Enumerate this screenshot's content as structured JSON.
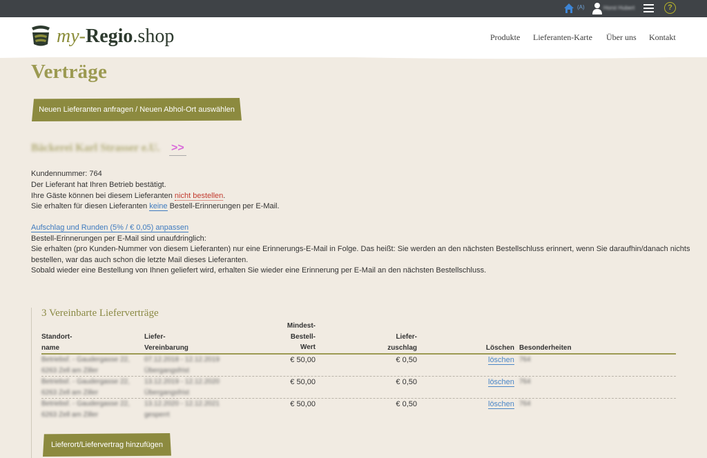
{
  "topbar": {
    "home_icon": "home-icon",
    "level": "(A)",
    "user_icon": "user-icon",
    "user_name": "Horst Hubert",
    "menu_icon": "hamburger-menu-icon",
    "help_label": "?"
  },
  "header": {
    "logo_my": "my-",
    "logo_regio": "Regio",
    "logo_shop": ".shop",
    "nav": [
      "Produkte",
      "Lieferanten-Karte",
      "Über uns",
      "Kontakt"
    ]
  },
  "page": {
    "title": "Verträge",
    "new_supplier_button": "Neuen Lieferanten anfragen / Neuen Abhol-Ort auswählen"
  },
  "supplier": {
    "name": "Bäckerei Karl Strasser e.U.",
    "link": ">>",
    "customer_number": "Kundennummer: 764",
    "confirmed": "Der Lieferant hat Ihren Betrieb bestätigt.",
    "guests_prefix": "Ihre Gäste können bei diesem Lieferanten ",
    "guests_link": "nicht bestellen",
    "guests_suffix": ".",
    "reminders_prefix": "Sie erhalten für diesen Lieferanten ",
    "reminders_link": "keine",
    "reminders_suffix": " Bestell-Erinnerungen per E-Mail.",
    "surcharge_link": "Aufschlag und Runden (5% / € 0,05) anpassen",
    "info": [
      "Bestell-Erinnerungen per E-Mail sind unaufdringlich:",
      "Sie erhalten (pro Kunden-Nummer von diesem Lieferanten) nur eine Erinnerungs-E-Mail in Folge. Das heißt: Sie werden an den nächsten Bestellschluss erinnert, wenn Sie daraufhin/danach nichts",
      "bestellen, war das auch schon die letzte Mail dieses Lieferanten.",
      "Sobald wieder eine Bestellung von Ihnen geliefert wird, erhalten Sie wieder eine Erinnerung per E-Mail an den nächsten Bestellschluss."
    ]
  },
  "contracts": {
    "title": "3 Vereinbarte Lieferverträge",
    "headers": {
      "location": [
        "Standort-",
        "name"
      ],
      "agreement": [
        "Liefer-",
        "Vereinbarung"
      ],
      "min_value": [
        "Mindest-",
        "Bestell-",
        "Wert"
      ],
      "surcharge": [
        "Liefer-",
        "zuschlag"
      ],
      "delete": "Löschen",
      "special": "Besonderheiten"
    },
    "rows": [
      {
        "location": [
          "Betriebsf. - Gaudergasse 22,",
          "6263 Zell am Ziller"
        ],
        "agreement": [
          "07.12.2018 - 12.12.2019",
          "Übergangsfrist"
        ],
        "min_value": "€ 50,00",
        "surcharge": "€ 0,50",
        "delete": "löschen",
        "special": "764"
      },
      {
        "location": [
          "Betriebsf. - Gaudergasse 22,",
          "6263 Zell am Ziller"
        ],
        "agreement": [
          "13.12.2019 - 12.12.2020",
          "Übergangsfrist"
        ],
        "min_value": "€ 50,00",
        "surcharge": "€ 0,50",
        "delete": "löschen",
        "special": "764"
      },
      {
        "location": [
          "Betriebsf. - Gaudergasse 22,",
          "6263 Zell am Ziller"
        ],
        "agreement": [
          "13.12.2020 - 12.12.2021",
          "gesperrt"
        ],
        "min_value": "€ 50,00",
        "surcharge": "€ 0,50",
        "delete": "löschen",
        "special": "764"
      }
    ],
    "add_button": "Lieferort/Liefervertrag hinzufügen"
  },
  "colors": {
    "topbar": "#3f4347",
    "accent": "#8c8a3f",
    "title": "#9c9a52",
    "background": "#f1ebe2",
    "link": "#3f7bbf",
    "warning_link": "#c23a2e"
  }
}
